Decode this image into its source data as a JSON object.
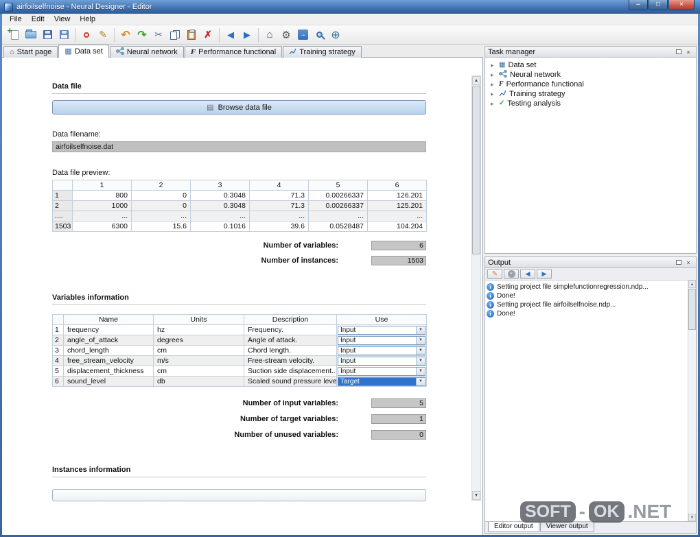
{
  "window": {
    "title": "airfoilselfnoise - Neural Designer - Editor"
  },
  "menu": {
    "items": [
      "File",
      "Edit",
      "View",
      "Help"
    ]
  },
  "toolbar": {
    "icons": [
      "new-project",
      "open-project",
      "save-project",
      "save-project-as",
      "record",
      "edit",
      "undo",
      "redo",
      "cut",
      "copy",
      "paste",
      "delete",
      "back",
      "forward",
      "home",
      "settings",
      "run",
      "zoom",
      "web-search"
    ]
  },
  "editor_tabs": [
    {
      "label": "Start page"
    },
    {
      "label": "Data set"
    },
    {
      "label": "Neural network"
    },
    {
      "label": "Performance functional"
    },
    {
      "label": "Training strategy"
    }
  ],
  "data_file": {
    "heading": "Data file",
    "browse_button": "Browse data file",
    "filename_label": "Data filename:",
    "filename_value": "airfoilselfnoise.dat",
    "preview_label": "Data file preview:",
    "preview_table": {
      "col_headers": [
        "1",
        "2",
        "3",
        "4",
        "5",
        "6"
      ],
      "rows": [
        {
          "label": "1",
          "values": [
            "800",
            "0",
            "0.3048",
            "71.3",
            "0.00266337",
            "126.201"
          ]
        },
        {
          "label": "2",
          "values": [
            "1000",
            "0",
            "0.3048",
            "71.3",
            "0.00266337",
            "125.201"
          ]
        },
        {
          "label": "....",
          "values": [
            "...",
            "...",
            "...",
            "...",
            "...",
            "..."
          ]
        },
        {
          "label": "1503",
          "values": [
            "6300",
            "15.6",
            "0.1016",
            "39.6",
            "0.0528487",
            "104.204"
          ]
        }
      ]
    },
    "counts": [
      {
        "label": "Number of variables:",
        "value": "6"
      },
      {
        "label": "Number of instances:",
        "value": "1503"
      }
    ]
  },
  "variables": {
    "heading": "Variables information",
    "table": {
      "col_headers": [
        "Name",
        "Units",
        "Description",
        "Use"
      ],
      "rows": [
        {
          "index": "1",
          "name": "frequency",
          "units": "hz",
          "description": "Frequency.",
          "use": "Input"
        },
        {
          "index": "2",
          "name": "angle_of_attack",
          "units": "degrees",
          "description": "Angle of attack.",
          "use": "Input"
        },
        {
          "index": "3",
          "name": "chord_length",
          "units": "cm",
          "description": "Chord length.",
          "use": "Input"
        },
        {
          "index": "4",
          "name": "free_stream_velocity",
          "units": "m/s",
          "description": "Free-stream velocity.",
          "use": "Input"
        },
        {
          "index": "5",
          "name": "displacement_thickness",
          "units": "cm",
          "description": "Suction side displacement...",
          "use": "Input"
        },
        {
          "index": "6",
          "name": "sound_level",
          "units": "db",
          "description": "Scaled sound pressure level.",
          "use": "Target"
        }
      ]
    },
    "counts": [
      {
        "label": "Number of input variables:",
        "value": "5"
      },
      {
        "label": "Number of target variables:",
        "value": "1"
      },
      {
        "label": "Number of unused variables:",
        "value": "0"
      }
    ]
  },
  "instances": {
    "heading": "Instances information"
  },
  "task_manager": {
    "title": "Task manager",
    "items": [
      {
        "label": "Data set"
      },
      {
        "label": "Neural network"
      },
      {
        "label": "Performance functional"
      },
      {
        "label": "Training strategy"
      },
      {
        "label": "Testing analysis"
      }
    ]
  },
  "output": {
    "title": "Output",
    "messages": [
      "Setting project file simplefunctionregression.ndp...",
      "Done!",
      "Setting project file airfoilselfnoise.ndp...",
      "Done!"
    ],
    "tabs": [
      {
        "label": "Editor output"
      },
      {
        "label": "Viewer output"
      }
    ]
  },
  "watermark": {
    "part1": "SOFT",
    "sep": "-",
    "part2": "OK",
    "part3": ".NET"
  },
  "colors": {
    "titlebar": "#3f74b4",
    "accent": "#3a6ea5",
    "selection": "#2e72d2",
    "info": "#1f64c0"
  }
}
